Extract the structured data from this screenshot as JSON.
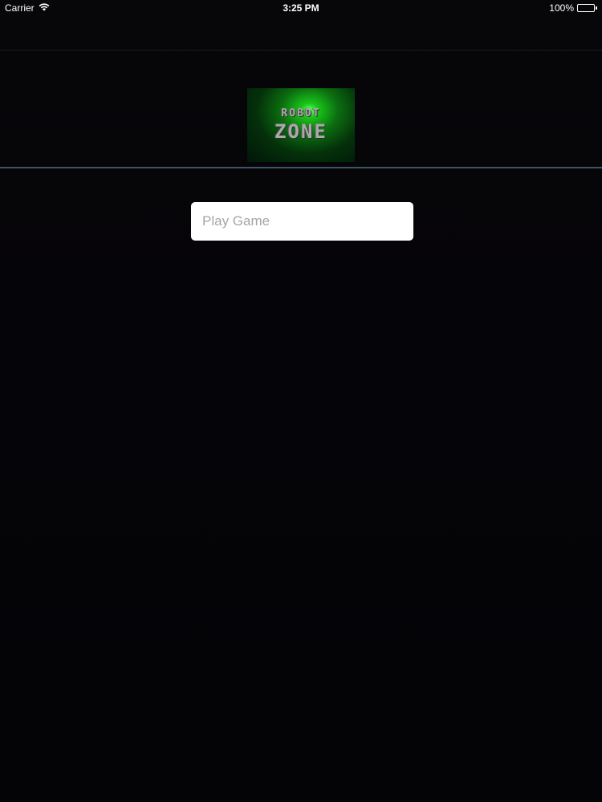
{
  "status_bar": {
    "carrier": "Carrier",
    "time": "3:25 PM",
    "battery": "100%",
    "battery_level": 1.0,
    "wifi_icon": "wifi-icon",
    "battery_icon": "battery-icon"
  },
  "header": {
    "logo_line1": "ROBOT",
    "logo_line2": "ZONE"
  },
  "main": {
    "play_placeholder": "Play Game"
  },
  "colors": {
    "background": "#050407",
    "divider": "#3f5567",
    "logo_glow": "#19c419",
    "field_background": "#ffffff",
    "placeholder_text": "#a6a6a6"
  }
}
